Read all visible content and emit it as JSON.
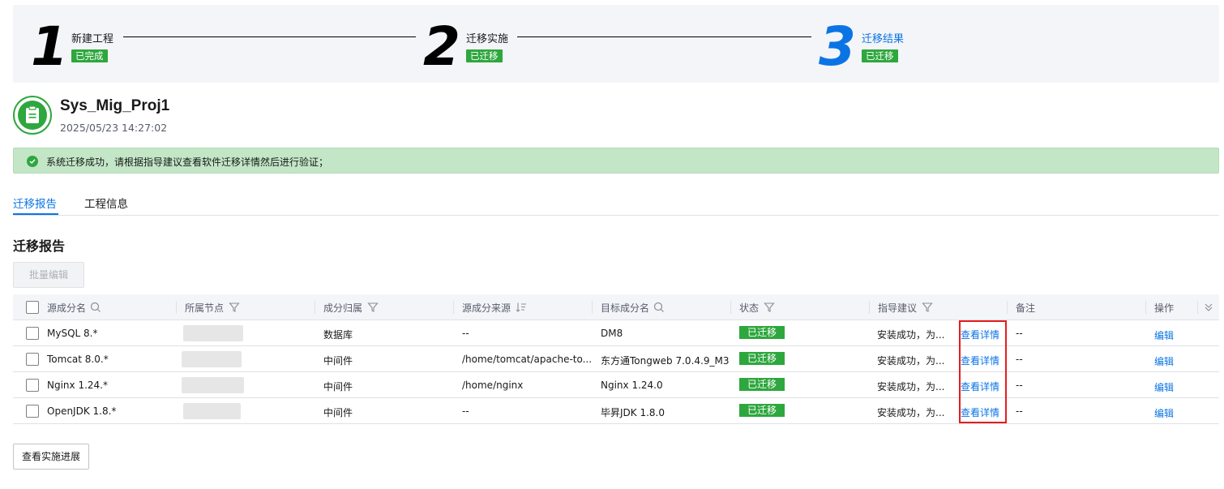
{
  "steps": [
    {
      "number": "1",
      "title": "新建工程",
      "badge": "已完成"
    },
    {
      "number": "2",
      "title": "迁移实施",
      "badge": "已迁移"
    },
    {
      "number": "3",
      "title": "迁移结果",
      "badge": "已迁移"
    }
  ],
  "project": {
    "name": "Sys_Mig_Proj1",
    "time": "2025/05/23 14:27:02",
    "icon": "clipboard-icon"
  },
  "alert": {
    "text": "系统迁移成功，请根据指导建议查看软件迁移详情然后进行验证；",
    "icon": "check-circle-icon"
  },
  "tabs": [
    {
      "label": "迁移报告"
    },
    {
      "label": "工程信息"
    }
  ],
  "section_title": "迁移报告",
  "batch_edit_label": "批量编辑",
  "table": {
    "headers": {
      "name": "源成分名",
      "node": "所属节点",
      "category": "成分归属",
      "source": "源成分来源",
      "target": "目标成分名",
      "status": "状态",
      "advice": "指导建议",
      "remark": "备注",
      "action": "操作"
    },
    "rows": [
      {
        "name": "MySQL 8.*",
        "category": "数据库",
        "source": "--",
        "target": "DM8",
        "status": "已迁移",
        "advice": "安装成功，为...",
        "advice_link": "查看详情",
        "remark": "--",
        "action": "编辑"
      },
      {
        "name": "Tomcat 8.0.*",
        "category": "中间件",
        "source": "/home/tomcat/apache-to...",
        "target": "东方通Tongweb 7.0.4.9_M3",
        "status": "已迁移",
        "advice": "安装成功，为...",
        "advice_link": "查看详情",
        "remark": "--",
        "action": "编辑"
      },
      {
        "name": "Nginx 1.24.*",
        "category": "中间件",
        "source": "/home/nginx",
        "target": "Nginx 1.24.0",
        "status": "已迁移",
        "advice": "安装成功，为...",
        "advice_link": "查看详情",
        "remark": "--",
        "action": "编辑"
      },
      {
        "name": "OpenJDK 1.8.*",
        "category": "中间件",
        "source": "--",
        "target": "毕昇JDK 1.8.0",
        "status": "已迁移",
        "advice": "安装成功，为...",
        "advice_link": "查看详情",
        "remark": "--",
        "action": "编辑"
      }
    ]
  },
  "view_progress_label": "查看实施进展",
  "colors": {
    "accent": "#0b74e5",
    "success": "#2ea73e",
    "alert_bg": "#c3e6c7",
    "highlight": "#e51d1d"
  }
}
